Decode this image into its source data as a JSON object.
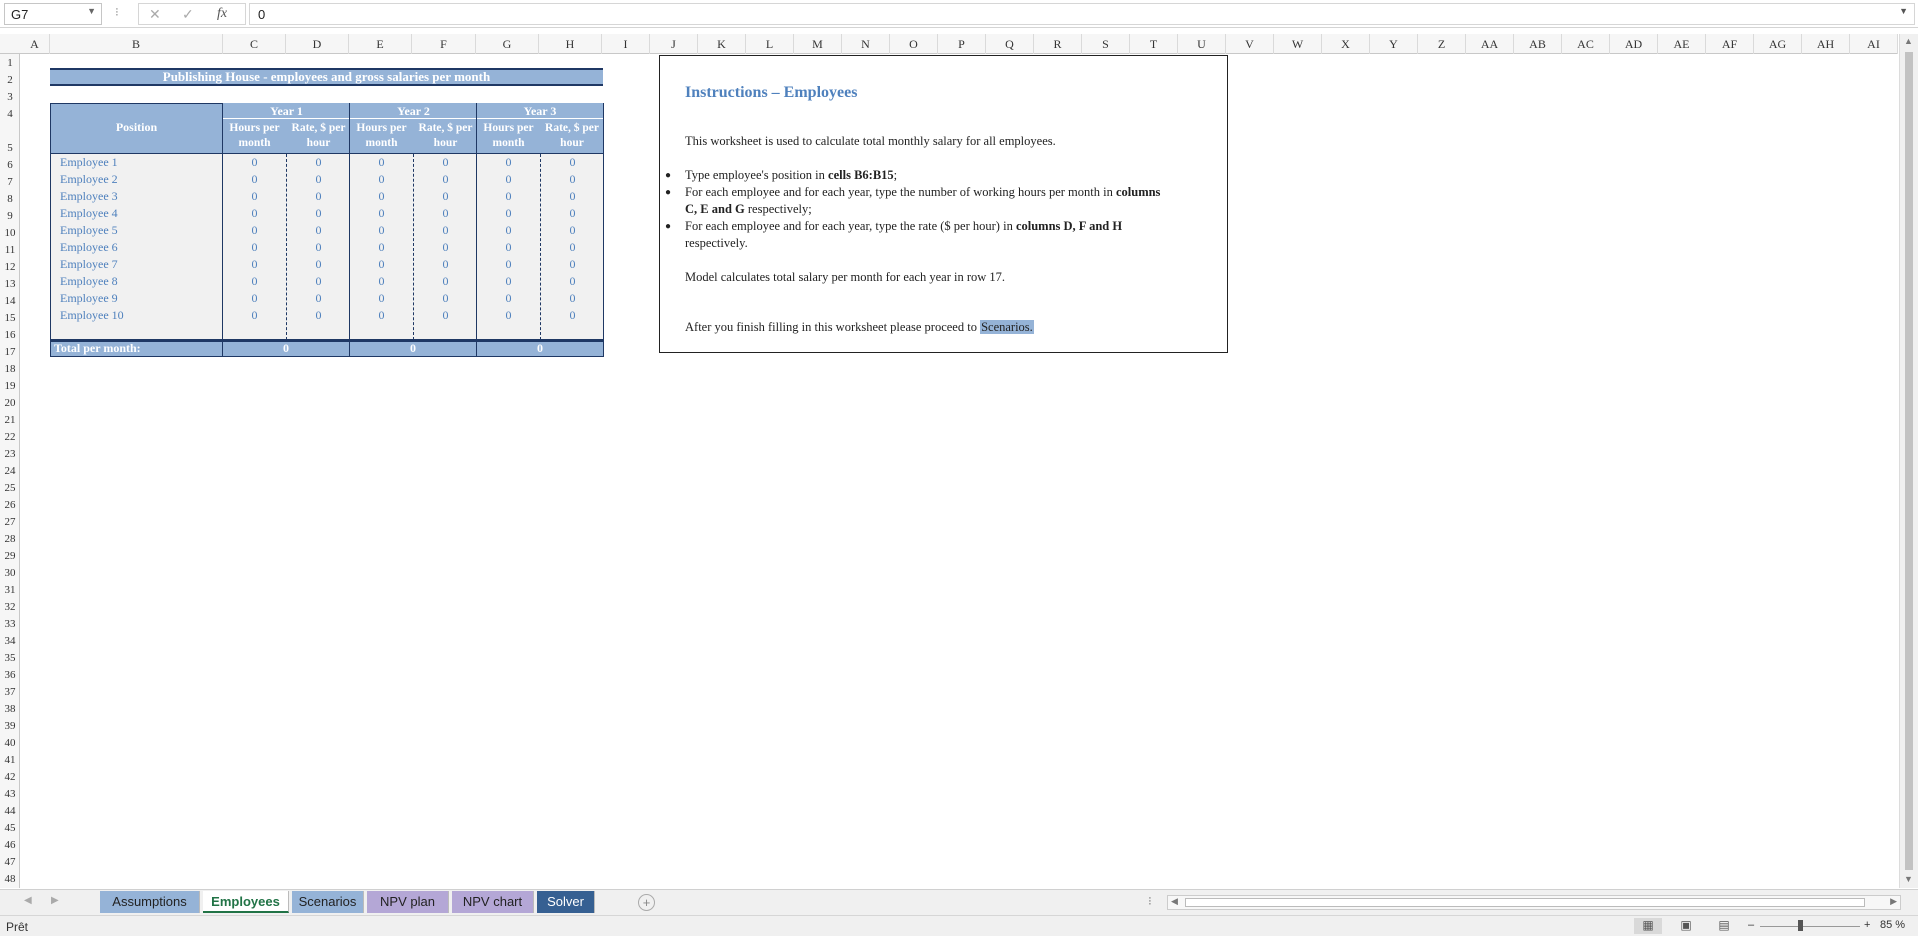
{
  "formula_bar": {
    "name_box": "G7",
    "value": "0",
    "cancel_icon": "✕",
    "enter_icon": "✓",
    "fx_label": "fx"
  },
  "columns": [
    "A",
    "B",
    "C",
    "D",
    "E",
    "F",
    "G",
    "H",
    "I",
    "J",
    "K",
    "L",
    "M",
    "N",
    "O",
    "P",
    "Q",
    "R",
    "S",
    "T",
    "U",
    "V",
    "W",
    "X",
    "Y",
    "Z",
    "AA",
    "AB",
    "AC",
    "AD",
    "AE",
    "AF",
    "AG",
    "AH",
    "AI"
  ],
  "rows": [
    "1",
    "2",
    "3",
    "4",
    "5",
    "6",
    "7",
    "8",
    "9",
    "10",
    "11",
    "12",
    "13",
    "14",
    "15",
    "16",
    "17",
    "18",
    "19",
    "20",
    "21",
    "22",
    "23",
    "24",
    "25",
    "26",
    "27",
    "28",
    "29",
    "30",
    "31",
    "32",
    "33",
    "34",
    "35",
    "36",
    "37",
    "38",
    "39",
    "40",
    "41",
    "42",
    "43",
    "44",
    "45",
    "46",
    "47",
    "48"
  ],
  "table": {
    "title": "Publishing House - employees and gross salaries per month",
    "position_header": "Position",
    "years": [
      "Year 1",
      "Year 2",
      "Year 3"
    ],
    "hours_header": "Hours per month",
    "rate_header": "Rate, $ per hour",
    "employees": [
      {
        "name": "Employee 1",
        "values": [
          "0",
          "0",
          "0",
          "0",
          "0",
          "0"
        ]
      },
      {
        "name": "Employee 2",
        "values": [
          "0",
          "0",
          "0",
          "0",
          "0",
          "0"
        ]
      },
      {
        "name": "Employee 3",
        "values": [
          "0",
          "0",
          "0",
          "0",
          "0",
          "0"
        ]
      },
      {
        "name": "Employee 4",
        "values": [
          "0",
          "0",
          "0",
          "0",
          "0",
          "0"
        ]
      },
      {
        "name": "Employee 5",
        "values": [
          "0",
          "0",
          "0",
          "0",
          "0",
          "0"
        ]
      },
      {
        "name": "Employee 6",
        "values": [
          "0",
          "0",
          "0",
          "0",
          "0",
          "0"
        ]
      },
      {
        "name": "Employee 7",
        "values": [
          "0",
          "0",
          "0",
          "0",
          "0",
          "0"
        ]
      },
      {
        "name": "Employee 8",
        "values": [
          "0",
          "0",
          "0",
          "0",
          "0",
          "0"
        ]
      },
      {
        "name": "Employee 9",
        "values": [
          "0",
          "0",
          "0",
          "0",
          "0",
          "0"
        ]
      },
      {
        "name": "Employee 10",
        "values": [
          "0",
          "0",
          "0",
          "0",
          "0",
          "0"
        ]
      }
    ],
    "total_label": "Total per month:",
    "totals": [
      "0",
      "0",
      "0"
    ]
  },
  "instructions": {
    "title": "Instructions – Employees",
    "intro": "This worksheet is used to calculate total monthly salary for all employees.",
    "b1_pre": "Type employee's position in ",
    "b1_bold": "cells B6:B15",
    "b1_post": ";",
    "b2_pre": "For each employee and for each year, type the number of working hours per month in ",
    "b2_bold1": "columns",
    "b2_bold2": "C, E and G",
    "b2_post": " respectively;",
    "b3_pre": "For each employee and for each year, type the rate ($ per hour) in ",
    "b3_bold": "columns D, F and H",
    "b3_post": "respectively.",
    "model_note": "Model calculates total salary per month for each year in row 17.",
    "finish_pre": "After you finish filling in this worksheet please proceed to ",
    "finish_link": "Scenarios."
  },
  "sheet_tabs": [
    {
      "label": "Assumptions",
      "color": "#95b3d7"
    },
    {
      "label": "Employees",
      "color": "#ffffff",
      "active": true
    },
    {
      "label": "Scenarios",
      "color": "#95b3d7"
    },
    {
      "label": "NPV plan",
      "color": "#b4a7d6"
    },
    {
      "label": "NPV chart",
      "color": "#b4a7d6"
    },
    {
      "label": "Solver",
      "color": "#366092"
    }
  ],
  "status_bar": {
    "ready": "Prêt",
    "zoom": "85 %",
    "zoom_minus": "–",
    "zoom_plus": "+"
  }
}
